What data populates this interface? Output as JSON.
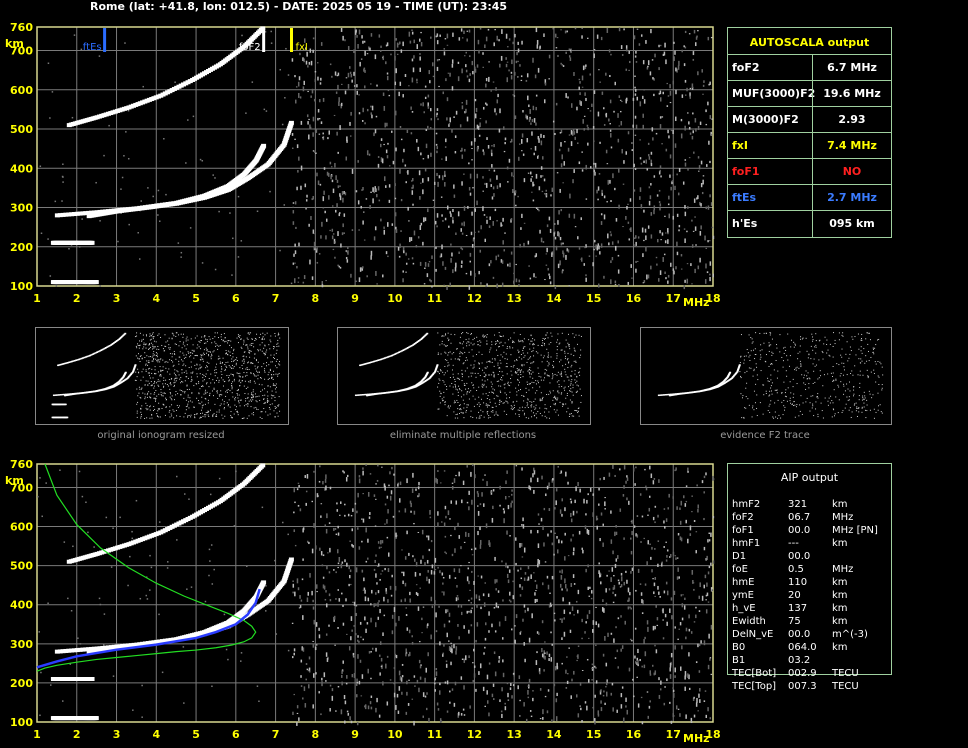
{
  "header": "Rome (lat: +41.8, lon: 012.5) - DATE: 2025 05 19 - TIME (UT): 23:45",
  "chart_data": [
    {
      "type": "scatter",
      "xlabel": "MHz",
      "ylabel": "km",
      "xlim": [
        1,
        18
      ],
      "ylim": [
        100,
        760
      ],
      "x_ticks": [
        1,
        2,
        3,
        4,
        5,
        6,
        7,
        8,
        9,
        10,
        11,
        12,
        13,
        14,
        15,
        16,
        17,
        18
      ],
      "y_ticks": [
        100,
        200,
        300,
        400,
        500,
        600,
        700,
        760
      ],
      "markers": [
        {
          "label": "ftEs",
          "x": 2.7,
          "color": "#2a6cff"
        },
        {
          "label": "foF2",
          "x": 6.7,
          "color": "#ffffff"
        },
        {
          "label": "fxI",
          "x": 7.4,
          "color": "#ffff00"
        }
      ],
      "traces": [
        {
          "name": "F2 o-trace",
          "x": [
            1.5,
            2.5,
            3.5,
            4.5,
            5.2,
            5.8,
            6.2,
            6.5,
            6.7
          ],
          "y": [
            280,
            288,
            298,
            312,
            330,
            355,
            385,
            420,
            460
          ]
        },
        {
          "name": "F2 x-trace",
          "x": [
            2.3,
            3.0,
            3.8,
            4.5,
            5.2,
            5.8,
            6.3,
            6.8,
            7.2,
            7.4
          ],
          "y": [
            278,
            290,
            300,
            310,
            325,
            345,
            375,
            410,
            460,
            520
          ]
        },
        {
          "name": "F2 2nd hop",
          "x": [
            1.8,
            2.5,
            3.3,
            4.1,
            4.9,
            5.6,
            6.2,
            6.7
          ],
          "y": [
            510,
            530,
            555,
            585,
            625,
            665,
            710,
            760
          ]
        },
        {
          "name": "Es",
          "x": [
            1.4,
            1.8,
            2.2,
            2.5
          ],
          "y": [
            110,
            110,
            110,
            110
          ]
        },
        {
          "name": "Es 2nd",
          "x": [
            1.4,
            1.7,
            2.0,
            2.4
          ],
          "y": [
            210,
            210,
            210,
            210
          ]
        }
      ]
    },
    {
      "type": "scatter",
      "xlabel": "MHz",
      "ylabel": "km",
      "xlim": [
        1,
        18
      ],
      "ylim": [
        100,
        760
      ],
      "x_ticks": [
        1,
        2,
        3,
        4,
        5,
        6,
        7,
        8,
        9,
        10,
        11,
        12,
        13,
        14,
        15,
        16,
        17,
        18
      ],
      "y_ticks": [
        100,
        200,
        300,
        400,
        500,
        600,
        700,
        760
      ],
      "profile_curve": {
        "x": [
          1.0,
          1.2,
          1.5,
          2.0,
          2.5,
          3.0,
          3.5,
          4.0,
          4.5,
          5.0,
          5.5,
          5.9,
          6.2,
          6.4,
          6.5,
          6.4,
          6.2,
          5.8,
          5.3,
          4.7,
          4.0,
          3.3,
          2.6,
          2.0,
          1.5,
          1.2
        ],
        "y": [
          230,
          238,
          245,
          253,
          260,
          265,
          270,
          275,
          280,
          284,
          290,
          297,
          305,
          315,
          330,
          345,
          360,
          378,
          398,
          422,
          455,
          495,
          545,
          605,
          680,
          760
        ]
      },
      "fit_trace": {
        "x": [
          1.0,
          1.5,
          2.0,
          3.0,
          4.0,
          5.0,
          5.5,
          6.0,
          6.3,
          6.5,
          6.6
        ],
        "y": [
          240,
          255,
          268,
          285,
          298,
          315,
          330,
          350,
          375,
          405,
          440
        ]
      }
    }
  ],
  "autoscala": {
    "title": "AUTOSCALA output",
    "rows": [
      {
        "label": "foF2",
        "value": "6.7 MHz",
        "color": "#ffffff"
      },
      {
        "label": "MUF(3000)F2",
        "value": "19.6 MHz",
        "color": "#ffffff"
      },
      {
        "label": "M(3000)F2",
        "value": "2.93",
        "color": "#ffffff"
      },
      {
        "label": "fxI",
        "value": "7.4 MHz",
        "color": "#ffff00"
      },
      {
        "label": "foF1",
        "value": "NO",
        "color": "#ff2020"
      },
      {
        "label": "ftEs",
        "value": "2.7 MHz",
        "color": "#3b7cff"
      },
      {
        "label": "h'Es",
        "value": "095    km",
        "color": "#ffffff"
      }
    ]
  },
  "aip": {
    "title": "AIP output",
    "rows": [
      {
        "label": "hmF2",
        "value": "321",
        "unit": "km"
      },
      {
        "label": "foF2",
        "value": "06.7",
        "unit": "MHz"
      },
      {
        "label": "foF1",
        "value": "00.0",
        "unit": "MHz   [PN]"
      },
      {
        "label": "hmF1",
        "value": "---",
        "unit": "km"
      },
      {
        "label": "D1",
        "value": "00.0",
        "unit": ""
      },
      {
        "label": "foE",
        "value": "0.5",
        "unit": "MHz"
      },
      {
        "label": "hmE",
        "value": "110",
        "unit": "km"
      },
      {
        "label": "ymE",
        "value": "20",
        "unit": "km"
      },
      {
        "label": "h_vE",
        "value": "137",
        "unit": "km"
      },
      {
        "label": "Ewidth",
        "value": "75",
        "unit": "km"
      },
      {
        "label": "DelN_vE",
        "value": "00.0",
        "unit": "m^(-3)"
      },
      {
        "label": "B0",
        "value": "064.0",
        "unit": "km"
      },
      {
        "label": "B1",
        "value": "03.2",
        "unit": ""
      },
      {
        "label": "TEC[Bot]",
        "value": "002.9",
        "unit": "TECU"
      },
      {
        "label": "TEC[Top]",
        "value": "007.3",
        "unit": "TECU"
      }
    ]
  },
  "thumbnails": [
    {
      "caption": "original ionogram resized"
    },
    {
      "caption": "eliminate multiple reflections"
    },
    {
      "caption": "evidence F2 trace"
    }
  ],
  "colors": {
    "grid": "#7a7a7a",
    "frame": "#d8d890",
    "axis_text": "#ffff00",
    "panel_border": "#9fd09f",
    "profile": "#22dd22",
    "fit": "#2a3cff"
  }
}
